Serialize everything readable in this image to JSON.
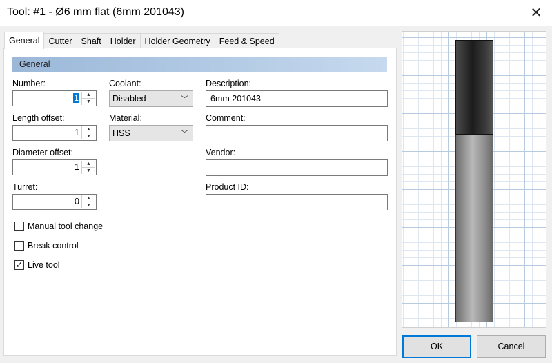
{
  "window": {
    "title": "Tool: #1 - Ø6 mm flat (6mm 201043)",
    "close_glyph": "✕"
  },
  "tabs": [
    "General",
    "Cutter",
    "Shaft",
    "Holder",
    "Holder Geometry",
    "Feed & Speed"
  ],
  "active_tab": "General",
  "section": {
    "title": "General"
  },
  "fields": {
    "number": {
      "label": "Number:",
      "value": "1"
    },
    "length_offset": {
      "label": "Length offset:",
      "value": "1"
    },
    "diameter_offset": {
      "label": "Diameter offset:",
      "value": "1"
    },
    "turret": {
      "label": "Turret:",
      "value": "0"
    },
    "coolant": {
      "label": "Coolant:",
      "value": "Disabled"
    },
    "material": {
      "label": "Material:",
      "value": "HSS"
    },
    "description": {
      "label": "Description:",
      "value": "6mm 201043"
    },
    "comment": {
      "label": "Comment:",
      "value": ""
    },
    "vendor": {
      "label": "Vendor:",
      "value": ""
    },
    "product_id": {
      "label": "Product ID:",
      "value": ""
    }
  },
  "checkboxes": {
    "manual_tool_change": {
      "label": "Manual tool change",
      "checked": false
    },
    "break_control": {
      "label": "Break control",
      "checked": false
    },
    "live_tool": {
      "label": "Live tool",
      "checked": true
    }
  },
  "buttons": {
    "ok": "OK",
    "cancel": "Cancel"
  },
  "icons": {
    "spin_up": "▲",
    "spin_down": "▼",
    "chevron": "﹀",
    "check": "✓"
  },
  "colors": {
    "accent": "#0078d7",
    "header_start": "#9bb8d9",
    "header_end": "#c6d9ee"
  }
}
